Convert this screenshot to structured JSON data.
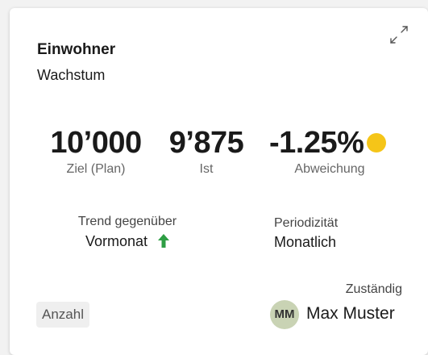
{
  "card": {
    "title": "Einwohner",
    "subtitle": "Wachstum"
  },
  "kpis": {
    "target": {
      "value": "10’000",
      "label": "Ziel (Plan)"
    },
    "actual": {
      "value": "9’875",
      "label": "Ist"
    },
    "deviation": {
      "value": "-1.25%",
      "label": "Abweichung",
      "status_color": "#f5c518"
    }
  },
  "trend": {
    "label": "Trend gegenüber",
    "value": "Vormonat",
    "direction_icon": "arrow-up-icon",
    "color": "#2e9e44"
  },
  "periodicity": {
    "label": "Periodizität",
    "value": "Monatlich"
  },
  "tag": {
    "label": "Anzahl"
  },
  "owner": {
    "label": "Zuständig",
    "initials": "MM",
    "name": "Max Muster"
  },
  "icons": {
    "expand": "expand-icon"
  }
}
